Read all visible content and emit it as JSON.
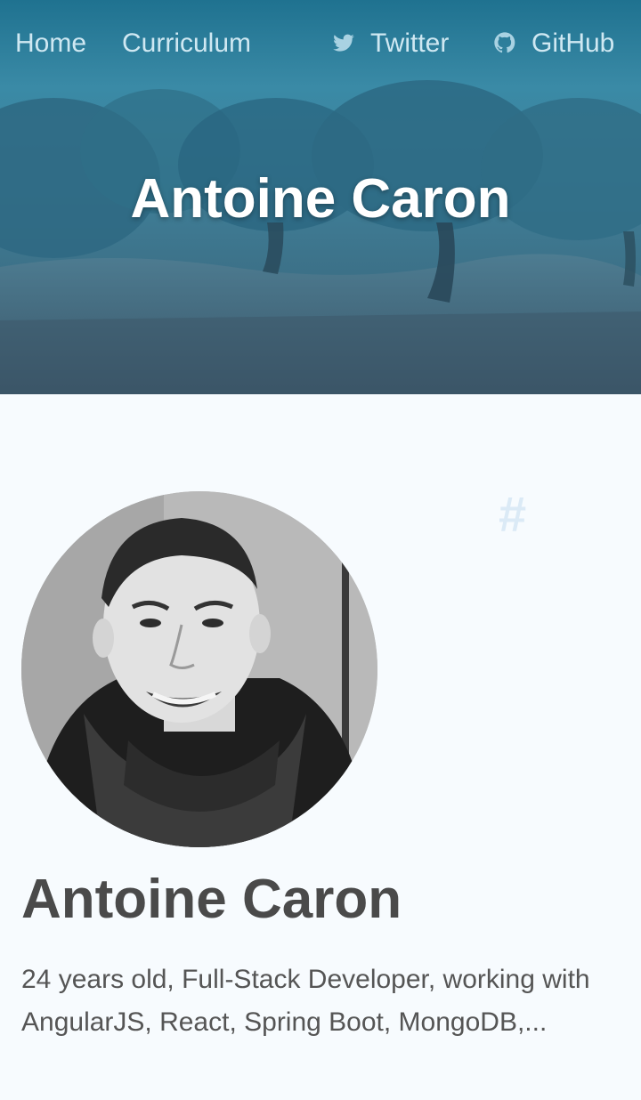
{
  "nav": {
    "home": "Home",
    "curriculum": "Curriculum",
    "twitter": "Twitter",
    "github": "GitHub"
  },
  "hero": {
    "title": "Antoine Caron"
  },
  "profile": {
    "anchor": "#",
    "name": "Antoine Caron",
    "bio": "24 years old, Full-Stack Developer, working with AngularJS, React, Spring Boot, MongoDB,..."
  },
  "colors": {
    "hero_overlay": "#2f7d9c",
    "nav_text": "#cfe8f2",
    "page_background": "#f7fbfe",
    "heading_text": "#4a4a4a",
    "body_text": "#555555",
    "anchor_hash": "#dbeaf6"
  },
  "icons": {
    "twitter": "twitter-bird-icon",
    "github": "github-octocat-icon"
  }
}
